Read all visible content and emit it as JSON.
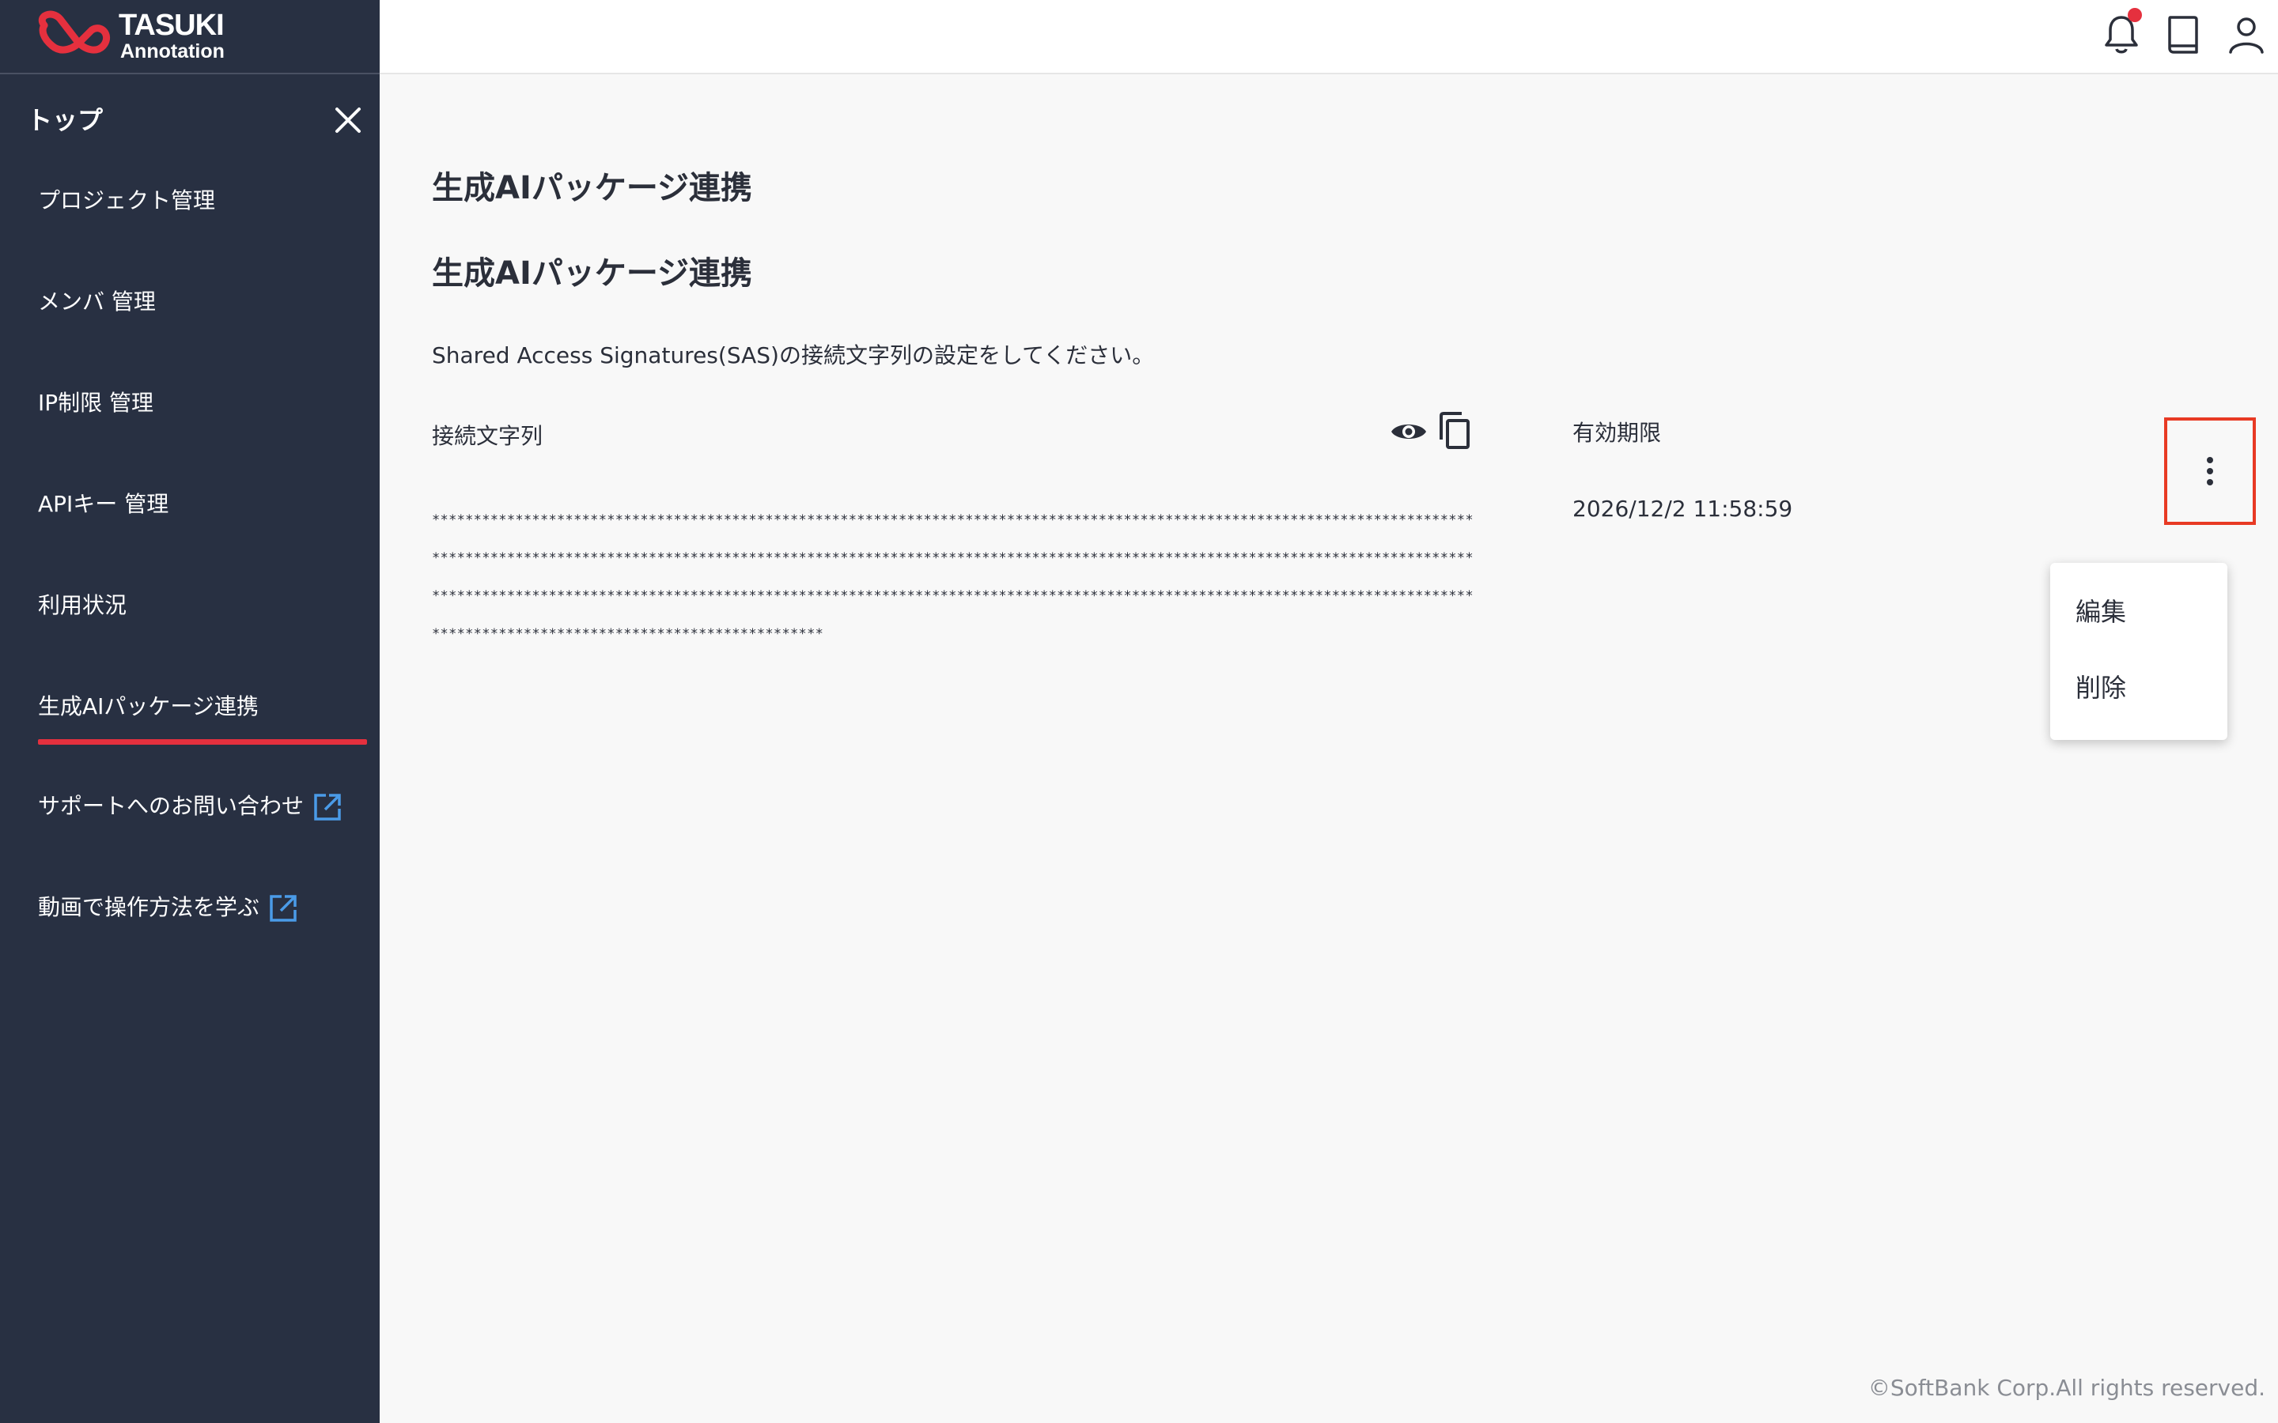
{
  "brand": {
    "name": "TASUKI",
    "sub": "Annotation",
    "accent_color": "#e5303e"
  },
  "sidebar": {
    "top_label": "トップ",
    "items": [
      {
        "label": "プロジェクト管理"
      },
      {
        "label": "メンバ 管理"
      },
      {
        "label": "IP制限 管理"
      },
      {
        "label": "APIキー 管理"
      },
      {
        "label": "利用状況"
      },
      {
        "label": "生成AIパッケージ連携",
        "active": true
      },
      {
        "label": "サポートへのお問い合わせ",
        "icon": "external-link-icon"
      },
      {
        "label": "動画で操作方法を学ぶ",
        "icon": "external-link-icon"
      }
    ]
  },
  "header": {
    "icons": [
      "bell-icon",
      "book-icon",
      "user-icon"
    ],
    "has_notification": true
  },
  "main": {
    "page_title": "生成AIパッケージ連携",
    "section_title": "生成AIパッケージ連携",
    "description": "Shared Access Signatures(SAS)の接続文字列の設定をしてください。",
    "connection_label": "接続文字列",
    "connection_value": "**************************************************************************************************************************************************************************************************************************************************************************************************************************************************************************************************************************************",
    "expiry_label": "有効期限",
    "expiry_value": "2026/12/2 11:58:59"
  },
  "menu": {
    "items": [
      {
        "label": "編集"
      },
      {
        "label": "削除"
      }
    ]
  },
  "footer": {
    "copyright": "©SoftBank Corp.All rights reserved."
  }
}
